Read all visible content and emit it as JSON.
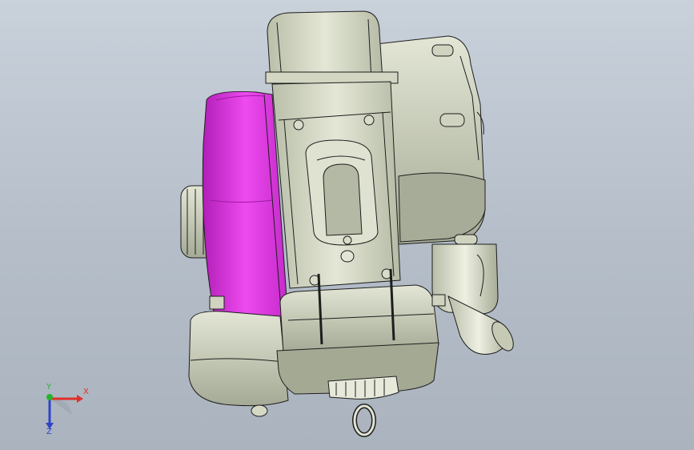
{
  "viewport": {
    "background_top": "#c9d1db",
    "background_bottom": "#aab3be",
    "part_colors": {
      "body": "#d8dcc8",
      "shade": "#aab09c",
      "flywheel": "#e23be6",
      "edge": "#1e1e1e"
    }
  },
  "triad": {
    "x_label": "X",
    "y_label": "Y",
    "z_label": "Z",
    "x_color": "#e0302a",
    "y_color": "#27b32c",
    "z_color": "#2f43c8"
  }
}
